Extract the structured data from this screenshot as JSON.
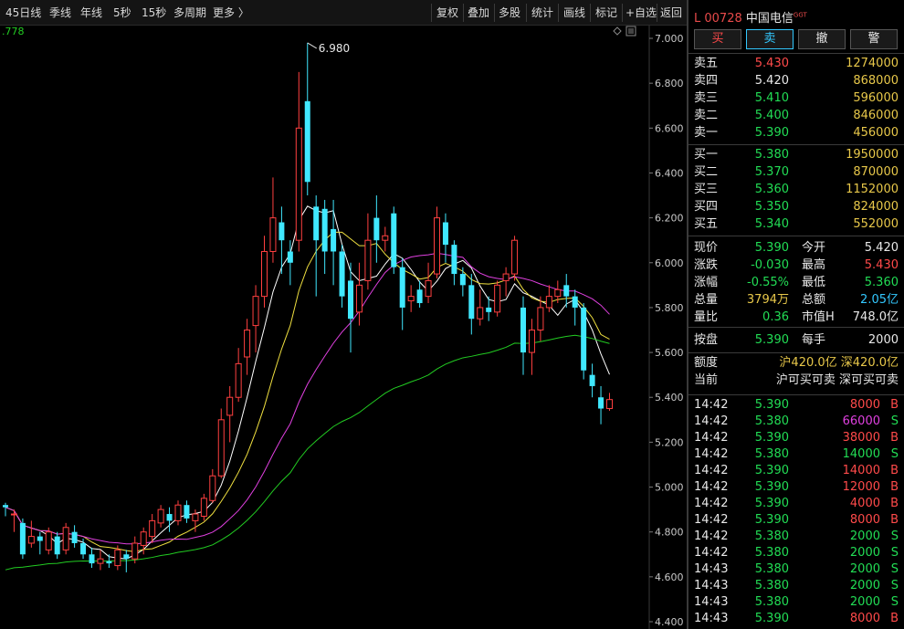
{
  "toolbar": {
    "periods": [
      "45日线",
      "季线",
      "年线",
      "5秒",
      "15秒",
      "多周期",
      "更多 〉"
    ],
    "buttons": [
      "复权",
      "叠加",
      "多股",
      "统计",
      "画线",
      "标记",
      "+自选",
      "返回"
    ]
  },
  "chart": {
    "ma_value": ".778",
    "high_label": "6.980",
    "price_ticks": [
      "7.000",
      "6.800",
      "6.600",
      "6.400",
      "6.200",
      "6.000",
      "5.800",
      "5.600",
      "5.400",
      "5.200",
      "5.000",
      "4.800",
      "4.600",
      "4.400"
    ],
    "colors": {
      "up": "#ff4040",
      "down": "#40e8ff",
      "ma5": "#ffffff",
      "ma10": "#f0e040",
      "ma20": "#e040e0",
      "ma60": "#22cc22"
    }
  },
  "chart_data": {
    "type": "candlestick",
    "ylim": [
      4.4,
      7.0
    ],
    "high_label": 6.98,
    "candles": [
      [
        4.92,
        4.91,
        4.93,
        4.87
      ],
      [
        4.88,
        4.88,
        4.9,
        4.8
      ],
      [
        4.84,
        4.7,
        4.86,
        4.68
      ],
      [
        4.75,
        4.78,
        4.85,
        4.73
      ],
      [
        4.78,
        4.76,
        4.8,
        4.7
      ],
      [
        4.72,
        4.8,
        4.82,
        4.7
      ],
      [
        4.78,
        4.7,
        4.8,
        4.68
      ],
      [
        4.72,
        4.82,
        4.84,
        4.7
      ],
      [
        4.8,
        4.75,
        4.83,
        4.73
      ],
      [
        4.75,
        4.7,
        4.77,
        4.68
      ],
      [
        4.7,
        4.66,
        4.73,
        4.64
      ],
      [
        4.66,
        4.68,
        4.72,
        4.63
      ],
      [
        4.67,
        4.66,
        4.7,
        4.64
      ],
      [
        4.65,
        4.72,
        4.74,
        4.63
      ],
      [
        4.7,
        4.68,
        4.72,
        4.62
      ],
      [
        4.68,
        4.75,
        4.78,
        4.66
      ],
      [
        4.74,
        4.8,
        4.82,
        4.7
      ],
      [
        4.78,
        4.85,
        4.88,
        4.75
      ],
      [
        4.84,
        4.9,
        4.92,
        4.82
      ],
      [
        4.88,
        4.85,
        4.91,
        4.8
      ],
      [
        4.85,
        4.92,
        4.94,
        4.83
      ],
      [
        4.92,
        4.86,
        4.94,
        4.84
      ],
      [
        4.85,
        4.88,
        4.9,
        4.8
      ],
      [
        4.87,
        4.95,
        4.97,
        4.85
      ],
      [
        4.94,
        5.05,
        5.08,
        4.93
      ],
      [
        5.05,
        5.3,
        5.35,
        5.04
      ],
      [
        5.32,
        5.4,
        5.45,
        5.2
      ],
      [
        5.4,
        5.55,
        5.62,
        5.38
      ],
      [
        5.58,
        5.7,
        5.75,
        5.5
      ],
      [
        5.72,
        5.85,
        5.9,
        5.6
      ],
      [
        5.85,
        6.05,
        6.12,
        5.8
      ],
      [
        6.05,
        6.2,
        6.38,
        6.0
      ],
      [
        6.18,
        6.1,
        6.25,
        5.95
      ],
      [
        6.05,
        6.0,
        6.1,
        5.9
      ],
      [
        6.1,
        6.6,
        6.85,
        6.05
      ],
      [
        6.72,
        6.36,
        6.98,
        6.3
      ],
      [
        6.25,
        6.1,
        6.3,
        5.85
      ],
      [
        6.24,
        6.05,
        6.28,
        5.95
      ],
      [
        6.15,
        6.05,
        6.28,
        5.9
      ],
      [
        6.05,
        5.85,
        6.08,
        5.8
      ],
      [
        5.92,
        5.75,
        6.0,
        5.6
      ],
      [
        5.78,
        5.9,
        6.0,
        5.72
      ],
      [
        5.92,
        6.1,
        6.22,
        5.88
      ],
      [
        6.2,
        6.1,
        6.3,
        6.0
      ],
      [
        6.1,
        6.12,
        6.16,
        6.05
      ],
      [
        6.22,
        5.98,
        6.25,
        5.95
      ],
      [
        5.98,
        5.8,
        6.02,
        5.7
      ],
      [
        5.83,
        5.85,
        5.9,
        5.78
      ],
      [
        5.88,
        5.82,
        5.92,
        5.8
      ],
      [
        5.85,
        5.92,
        6.0,
        5.82
      ],
      [
        5.95,
        6.2,
        6.25,
        5.93
      ],
      [
        6.18,
        6.08,
        6.22,
        6.0
      ],
      [
        6.08,
        5.95,
        6.1,
        5.9
      ],
      [
        5.95,
        5.9,
        5.98,
        5.85
      ],
      [
        5.9,
        5.75,
        5.95,
        5.68
      ],
      [
        5.75,
        5.8,
        5.88,
        5.72
      ],
      [
        5.8,
        5.78,
        5.85,
        5.74
      ],
      [
        5.78,
        5.9,
        5.92,
        5.76
      ],
      [
        5.92,
        5.95,
        5.98,
        5.85
      ],
      [
        5.95,
        6.1,
        6.12,
        5.92
      ],
      [
        5.8,
        5.6,
        5.85,
        5.5
      ],
      [
        5.6,
        5.7,
        5.75,
        5.5
      ],
      [
        5.7,
        5.8,
        5.85,
        5.65
      ],
      [
        5.8,
        5.85,
        5.9,
        5.78
      ],
      [
        5.85,
        5.88,
        5.92,
        5.82
      ],
      [
        5.9,
        5.85,
        5.95,
        5.8
      ],
      [
        5.85,
        5.8,
        5.88,
        5.72
      ],
      [
        5.8,
        5.52,
        5.82,
        5.48
      ],
      [
        5.5,
        5.45,
        5.55,
        5.4
      ],
      [
        5.4,
        5.35,
        5.45,
        5.28
      ],
      [
        5.35,
        5.39,
        5.42,
        5.34
      ]
    ]
  },
  "panel": {
    "code": "L 00728",
    "name": "中国电信",
    "tag": "GGT",
    "trade_buttons": [
      {
        "label": "买",
        "color": "#ff4a4a"
      },
      {
        "label": "卖",
        "color": "#33c8ff"
      },
      {
        "label": "撤",
        "color": "#e8e8e8"
      },
      {
        "label": "警",
        "color": "#e8e8e8"
      }
    ],
    "asks": [
      {
        "label": "卖五",
        "price": "5.430",
        "vol": "1274000",
        "pc": "red"
      },
      {
        "label": "卖四",
        "price": "5.420",
        "vol": "868000",
        "pc": "white"
      },
      {
        "label": "卖三",
        "price": "5.410",
        "vol": "596000",
        "pc": "green"
      },
      {
        "label": "卖二",
        "price": "5.400",
        "vol": "846000",
        "pc": "green"
      },
      {
        "label": "卖一",
        "price": "5.390",
        "vol": "456000",
        "pc": "green"
      }
    ],
    "bids": [
      {
        "label": "买一",
        "price": "5.380",
        "vol": "1950000",
        "pc": "green"
      },
      {
        "label": "买二",
        "price": "5.370",
        "vol": "870000",
        "pc": "green"
      },
      {
        "label": "买三",
        "price": "5.360",
        "vol": "1152000",
        "pc": "green"
      },
      {
        "label": "买四",
        "price": "5.350",
        "vol": "824000",
        "pc": "green"
      },
      {
        "label": "买五",
        "price": "5.340",
        "vol": "552000",
        "pc": "green"
      }
    ],
    "stats": [
      {
        "l1": "现价",
        "v1": "5.390",
        "c1": "green",
        "l2": "今开",
        "v2": "5.420",
        "c2": "white"
      },
      {
        "l1": "涨跌",
        "v1": "-0.030",
        "c1": "green",
        "l2": "最高",
        "v2": "5.430",
        "c2": "red"
      },
      {
        "l1": "涨幅",
        "v1": "-0.55%",
        "c1": "green",
        "l2": "最低",
        "v2": "5.360",
        "c2": "green"
      },
      {
        "l1": "总量",
        "v1": "3794万",
        "c1": "yellow",
        "l2": "总额",
        "v2": "2.05亿",
        "c2": "cyan"
      },
      {
        "l1": "量比",
        "v1": "0.36",
        "c1": "green",
        "l2": "市值H",
        "v2": "748.0亿",
        "c2": "white"
      }
    ],
    "pan": {
      "l1": "按盘",
      "v1": "5.390",
      "l2": "每手",
      "v2": "2000"
    },
    "quota": {
      "label": "额度",
      "v": "沪420.0亿 深420.0亿"
    },
    "current": {
      "label": "当前",
      "v": "沪可买可卖 深可买可卖"
    },
    "ticks": [
      {
        "t": "14:42",
        "p": "5.390",
        "v": "8000",
        "vc": "red",
        "s": "B"
      },
      {
        "t": "14:42",
        "p": "5.380",
        "v": "66000",
        "vc": "purple",
        "s": "S"
      },
      {
        "t": "14:42",
        "p": "5.390",
        "v": "38000",
        "vc": "red",
        "s": "B"
      },
      {
        "t": "14:42",
        "p": "5.380",
        "v": "14000",
        "vc": "green",
        "s": "S"
      },
      {
        "t": "14:42",
        "p": "5.390",
        "v": "14000",
        "vc": "red",
        "s": "B"
      },
      {
        "t": "14:42",
        "p": "5.390",
        "v": "12000",
        "vc": "red",
        "s": "B"
      },
      {
        "t": "14:42",
        "p": "5.390",
        "v": "4000",
        "vc": "red",
        "s": "B"
      },
      {
        "t": "14:42",
        "p": "5.390",
        "v": "8000",
        "vc": "red",
        "s": "B"
      },
      {
        "t": "14:42",
        "p": "5.380",
        "v": "2000",
        "vc": "green",
        "s": "S"
      },
      {
        "t": "14:42",
        "p": "5.380",
        "v": "2000",
        "vc": "green",
        "s": "S"
      },
      {
        "t": "14:43",
        "p": "5.380",
        "v": "2000",
        "vc": "green",
        "s": "S"
      },
      {
        "t": "14:43",
        "p": "5.380",
        "v": "2000",
        "vc": "green",
        "s": "S"
      },
      {
        "t": "14:43",
        "p": "5.380",
        "v": "2000",
        "vc": "green",
        "s": "S"
      },
      {
        "t": "14:43",
        "p": "5.390",
        "v": "8000",
        "vc": "red",
        "s": "B"
      }
    ]
  }
}
